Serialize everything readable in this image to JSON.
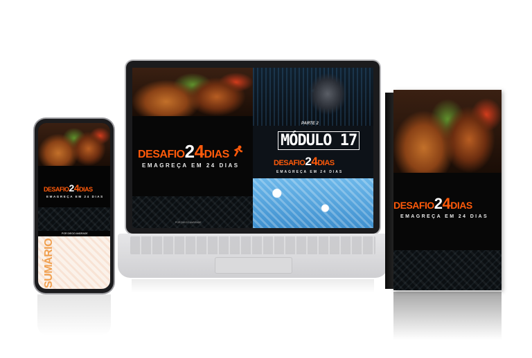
{
  "brand": {
    "logo_prefix": "DESAFIO",
    "logo_num_a": "2",
    "logo_num_b": "4",
    "logo_suffix": "DIAS",
    "tagline": "EMAGREÇA EM 24 DIAS"
  },
  "laptop": {
    "module_part": "PARTE 2",
    "module_title": "MÓDULO 17",
    "footer_credit": "POR DIEGO ANDRADE"
  },
  "phone": {
    "credit": "POR DIEGO ANDRADE",
    "summary_word": "SUMÁRIO"
  },
  "colors": {
    "accent": "#ff5a0a",
    "dark": "#0b0b0b",
    "laptop_body": "#d9d9dc"
  }
}
